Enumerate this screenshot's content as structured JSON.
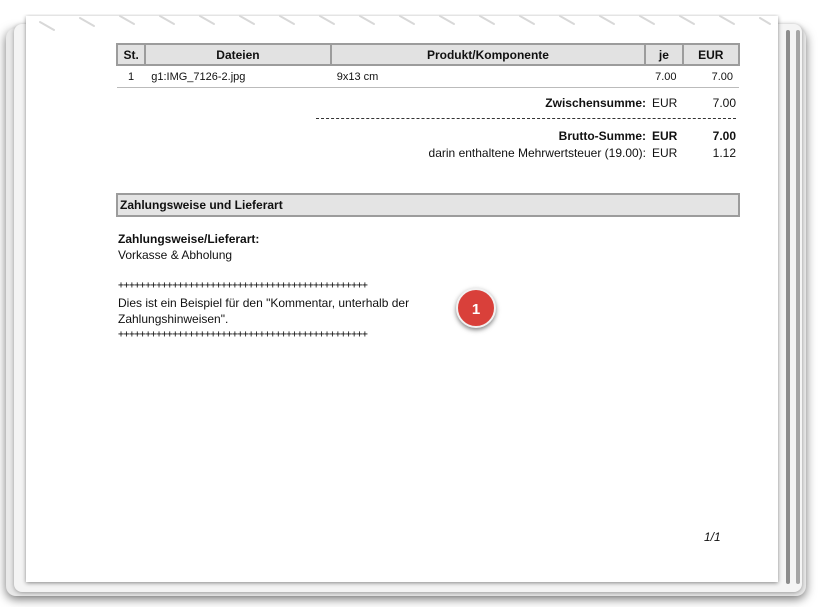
{
  "table": {
    "headers": [
      "St.",
      "Dateien",
      "Produkt/Komponente",
      "je",
      "EUR"
    ],
    "rows": [
      {
        "qty": "1",
        "file": "g1:IMG_7126-2.jpg",
        "product": "9x13 cm",
        "unit": "7.00",
        "total": "7.00"
      }
    ]
  },
  "totals": {
    "subtotal_label": "Zwischensumme:",
    "subtotal_currency": "EUR",
    "subtotal_value": "7.00",
    "gross_label": "Brutto-Summe:",
    "gross_currency": "EUR",
    "gross_value": "7.00",
    "vat_label": "darin enthaltene Mehrwertsteuer (19.00):",
    "vat_currency": "EUR",
    "vat_value": "1.12"
  },
  "payment": {
    "section_title": "Zahlungsweise und Lieferart",
    "heading": "Zahlungsweise/Lieferart:",
    "value": "Vorkasse & Abholung"
  },
  "comment": {
    "plus_line": "++++++++++++++++++++++++++++++++++++++++++++++",
    "line1": "Dies ist ein Beispiel für den \"Kommentar, unterhalb der",
    "line2": "Zahlungshinweisen\"."
  },
  "badge": "1",
  "page_number": "1/1"
}
